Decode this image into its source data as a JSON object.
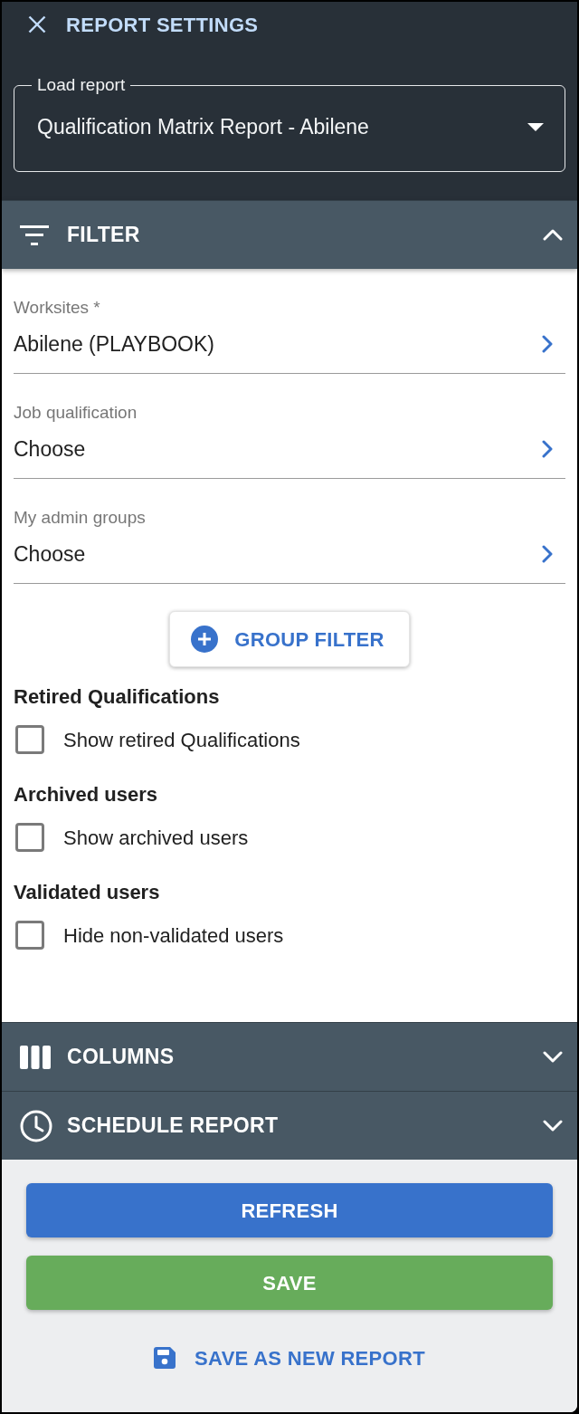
{
  "header": {
    "title": "REPORT SETTINGS",
    "load_report": {
      "label": "Load report",
      "value": "Qualification Matrix Report - Abilene"
    }
  },
  "sections": [
    {
      "kind": "filter",
      "title": "FILTER",
      "expanded": true,
      "pickers": [
        {
          "label": "Worksites *",
          "value": "Abilene (PLAYBOOK)"
        },
        {
          "label": "Job qualification",
          "value": "Choose"
        },
        {
          "label": "My admin groups",
          "value": "Choose"
        }
      ],
      "group_button": "GROUP FILTER",
      "options": [
        {
          "heading": "Retired Qualifications",
          "label": "Show retired Qualifications",
          "checked": false
        },
        {
          "heading": "Archived users",
          "label": "Show archived users",
          "checked": false
        },
        {
          "heading": "Validated users",
          "label": "Hide non-validated users",
          "checked": false
        }
      ]
    },
    {
      "kind": "columns",
      "title": "COLUMNS",
      "expanded": false
    },
    {
      "kind": "schedule",
      "title": "SCHEDULE REPORT",
      "expanded": false
    }
  ],
  "actions": [
    {
      "kind": "primary",
      "label": "REFRESH"
    },
    {
      "kind": "success",
      "label": "SAVE"
    },
    {
      "kind": "link",
      "label": "SAVE AS NEW REPORT"
    }
  ]
}
